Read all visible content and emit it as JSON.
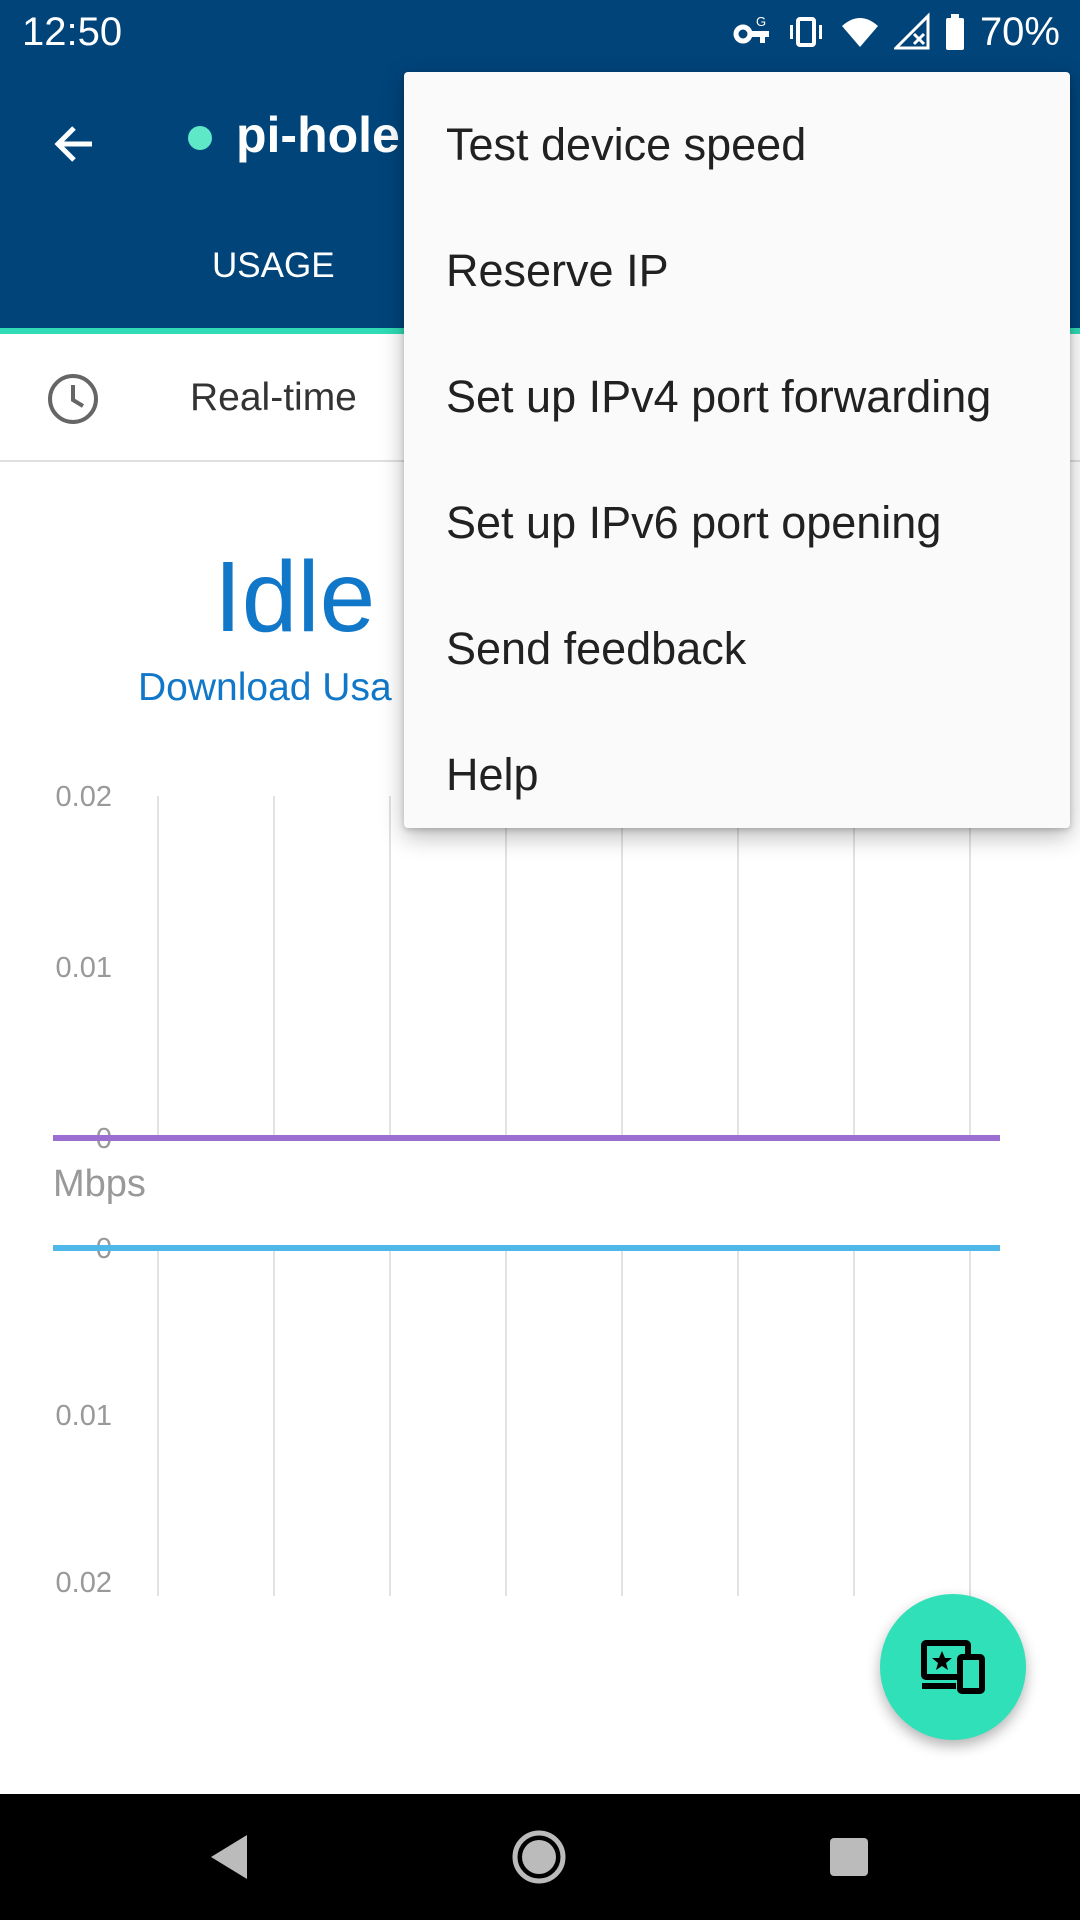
{
  "status_bar": {
    "time": "12:50",
    "battery_percent": "70%",
    "icons": [
      "vpn-key-icon",
      "vibrate-icon",
      "wifi-icon",
      "signal-icon",
      "battery-icon"
    ]
  },
  "app_bar": {
    "device_name": "pi-hole",
    "status_color": "#5ee8c8",
    "tabs": [
      {
        "label": "USAGE",
        "selected": true
      }
    ]
  },
  "filter": {
    "label": "Real-time",
    "icon": "clock-icon"
  },
  "usage": {
    "status": "Idle",
    "download_link": "Download Usa"
  },
  "chart_data": [
    {
      "type": "line",
      "series": [
        {
          "values": [
            0,
            0,
            0,
            0,
            0,
            0,
            0,
            0
          ],
          "color": "#9b6fd1"
        }
      ],
      "yticks": [
        "0.02",
        "0.01",
        "0"
      ],
      "ylim": [
        0,
        0.02
      ],
      "grid": true
    },
    {
      "type": "line",
      "series": [
        {
          "values": [
            0,
            0,
            0,
            0,
            0,
            0,
            0,
            0
          ],
          "color": "#4fb8e8"
        }
      ],
      "yticks": [
        "0",
        "0.01",
        "0.02"
      ],
      "ylim": [
        0,
        0.02
      ],
      "inverted": true,
      "grid": true
    }
  ],
  "unit_label": "Mbps",
  "menu": {
    "items": [
      {
        "label": "Test device speed"
      },
      {
        "label": "Reserve IP"
      },
      {
        "label": "Set up IPv4 port forwarding"
      },
      {
        "label": "Set up IPv6 port opening"
      },
      {
        "label": "Send feedback"
      },
      {
        "label": "Help"
      }
    ]
  },
  "fab": {
    "icon": "devices-star-icon"
  },
  "nav": {
    "icons": [
      "back-triangle-icon",
      "home-circle-icon",
      "recents-square-icon"
    ]
  }
}
